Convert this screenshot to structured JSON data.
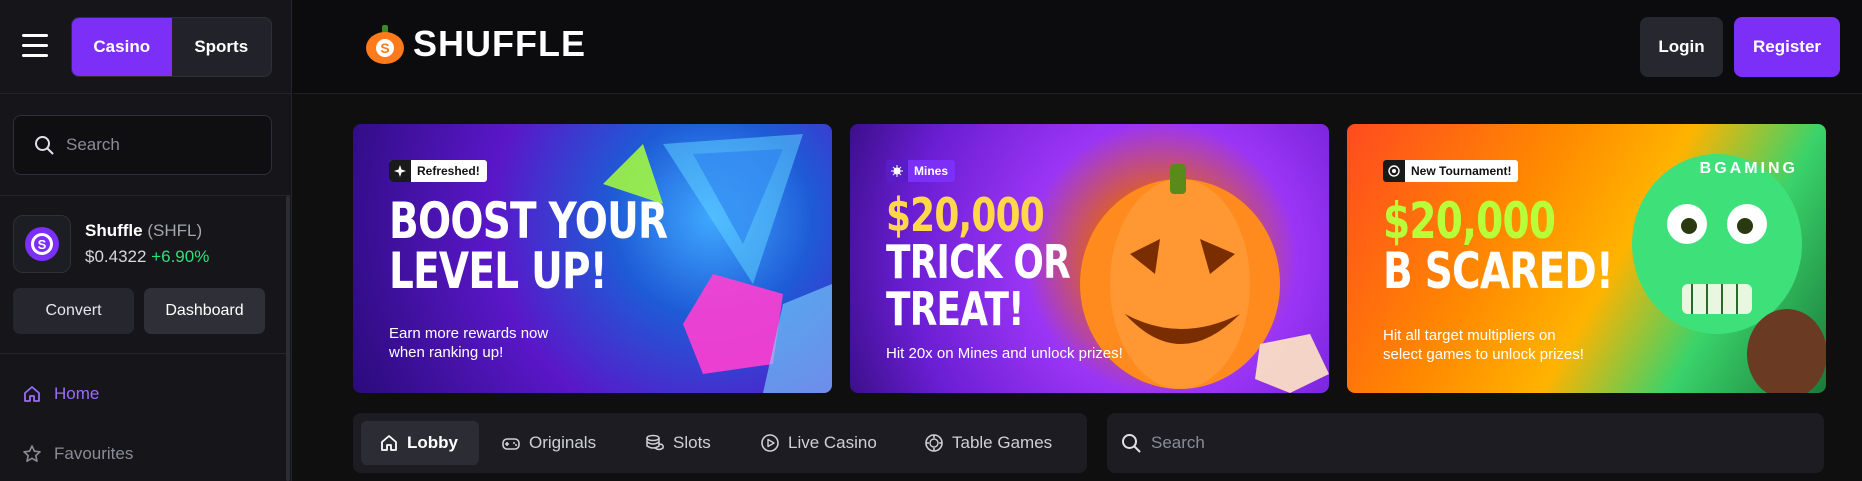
{
  "header": {
    "mode_tabs": [
      {
        "label": "Casino"
      },
      {
        "label": "Sports"
      }
    ],
    "logo_text": "SHUFFLE",
    "login_label": "Login",
    "register_label": "Register",
    "accent_color": "#7b2ff7"
  },
  "sidebar": {
    "search_placeholder": "Search",
    "token": {
      "name": "Shuffle",
      "symbol": "(SHFL)",
      "price": "$0.4322",
      "change": "+6.90%",
      "change_color": "#2ee07a"
    },
    "convert_label": "Convert",
    "dashboard_label": "Dashboard",
    "nav": [
      {
        "label": "Home",
        "icon": "home-icon"
      },
      {
        "label": "Favourites",
        "icon": "star-icon"
      }
    ]
  },
  "banners": [
    {
      "tag": "Refreshed!",
      "title_lines": [
        "BOOST YOUR",
        "LEVEL UP!"
      ],
      "subtitle_lines": [
        "Earn more rewards now",
        "when ranking up!"
      ]
    },
    {
      "tag": "Mines",
      "title_lines": [
        "$20,000",
        "TRICK OR",
        "TREAT!"
      ],
      "subtitle_lines": [
        "Hit 20x on Mines and unlock prizes!"
      ]
    },
    {
      "tag": "New Tournament!",
      "title_lines": [
        "$20,000",
        "B SCARED!"
      ],
      "subtitle_lines": [
        "Hit all target multipliers on",
        "select games to unlock prizes!"
      ],
      "brand": "BGAMING"
    }
  ],
  "tabs": [
    {
      "label": "Lobby",
      "icon": "home-icon",
      "active": true
    },
    {
      "label": "Originals",
      "icon": "gamepad-icon"
    },
    {
      "label": "Slots",
      "icon": "coin-stack-icon"
    },
    {
      "label": "Live Casino",
      "icon": "play-circle-icon"
    },
    {
      "label": "Table Games",
      "icon": "chip-icon"
    }
  ],
  "main_search_placeholder": "Search"
}
